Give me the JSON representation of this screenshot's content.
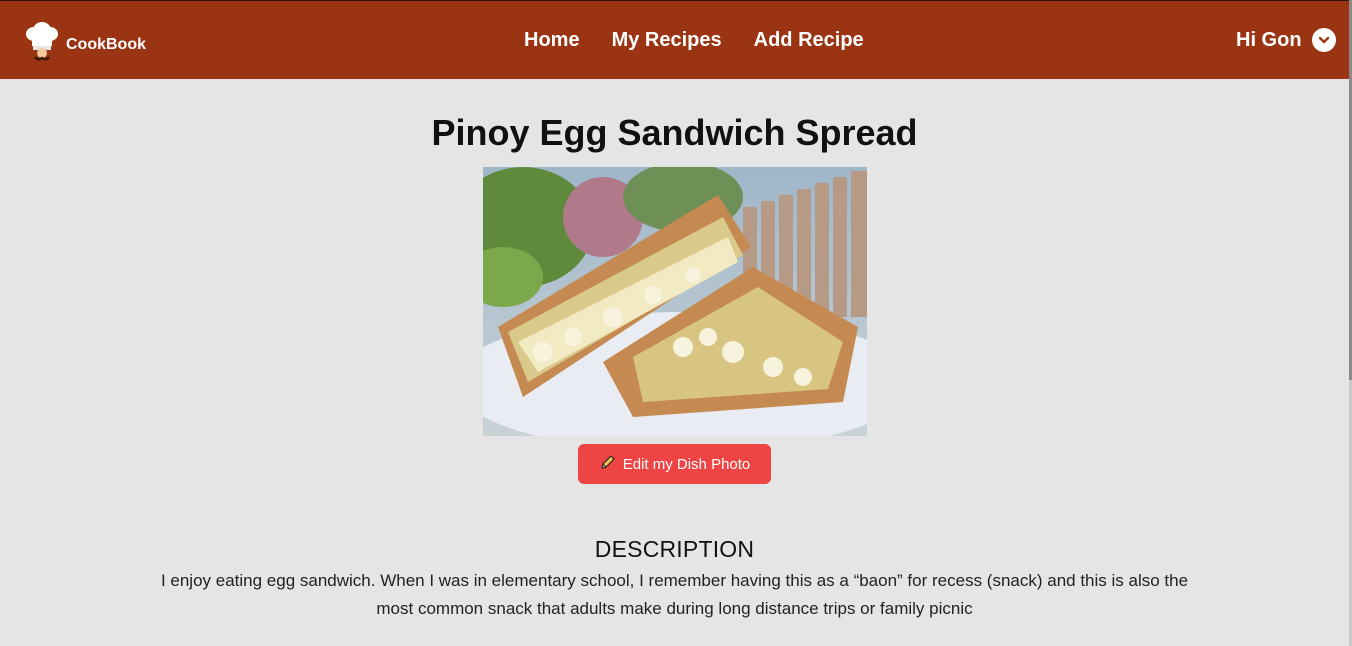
{
  "navbar": {
    "brand": "CookBook",
    "links": [
      "Home",
      "My Recipes",
      "Add Recipe"
    ],
    "user_greeting": "Hi Gon",
    "background": "#9a3412"
  },
  "recipe": {
    "title": "Pinoy Egg Sandwich Spread",
    "edit_photo_label": "Edit my Dish Photo",
    "description_heading": "DESCRIPTION",
    "description": "I enjoy eating egg sandwich. When I was in elementary school, I remember having this as a “baon” for recess (snack) and this is also the most common snack that adults make during long distance trips or family picnic"
  },
  "icons": {
    "logo": "chef-hat-icon",
    "user_menu": "chevron-down-icon",
    "edit": "pencil-icon"
  },
  "colors": {
    "accent_button": "#ef4444",
    "page_background": "#e5e5e5"
  }
}
